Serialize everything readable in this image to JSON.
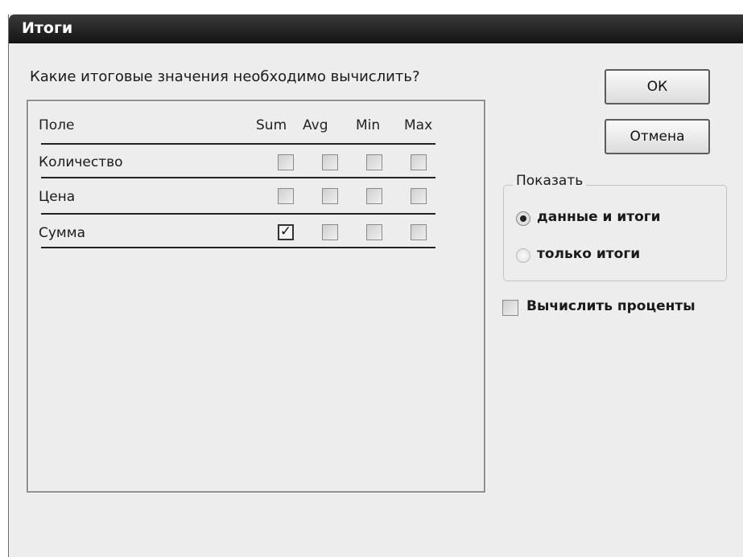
{
  "window": {
    "title": "Итоги"
  },
  "question": "Какие итоговые значения необходимо вычислить?",
  "table": {
    "columns": [
      "Поле",
      "Sum",
      "Avg",
      "Min",
      "Max"
    ],
    "rows": [
      {
        "label": "Количество",
        "checked": [
          false,
          false,
          false,
          false
        ]
      },
      {
        "label": "Цена",
        "checked": [
          false,
          false,
          false,
          false
        ]
      },
      {
        "label": "Сумма",
        "checked": [
          true,
          false,
          false,
          false
        ]
      }
    ]
  },
  "buttons": {
    "ok": "ОК",
    "cancel": "Отмена"
  },
  "show_group": {
    "legend": "Показать",
    "options": [
      {
        "label": "данные и итоги",
        "selected": true
      },
      {
        "label": "только итоги",
        "selected": false
      }
    ]
  },
  "percent_checkbox": {
    "label": "Вычислить проценты",
    "checked": false
  }
}
